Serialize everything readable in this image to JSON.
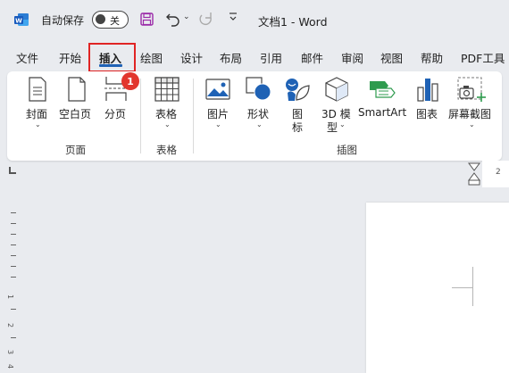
{
  "titlebar": {
    "autosave_label": "自动保存",
    "autosave_state": "关",
    "doc_title": "文档1  -  Word"
  },
  "tabs": [
    {
      "label": "文件"
    },
    {
      "label": "开始"
    },
    {
      "label": "插入",
      "active": true
    },
    {
      "label": "绘图"
    },
    {
      "label": "设计"
    },
    {
      "label": "布局"
    },
    {
      "label": "引用"
    },
    {
      "label": "邮件"
    },
    {
      "label": "审阅"
    },
    {
      "label": "视图"
    },
    {
      "label": "帮助"
    },
    {
      "label": "PDF工具"
    }
  ],
  "annotation": {
    "badge_number": "1",
    "highlight_color": "#e02424"
  },
  "ribbon": {
    "groups": {
      "pages": "页面",
      "tables": "表格",
      "illustrations": "插图"
    },
    "buttons": {
      "cover": "封面",
      "blank_page": "空白页",
      "page_break": "分页",
      "table": "表格",
      "pictures": "图片",
      "shapes": "形状",
      "icons_line1": "图",
      "icons_line2": "标",
      "model_line1": "3D 模",
      "model_line2": "型",
      "smartart": "SmartArt",
      "chart": "图表",
      "screenshot": "屏幕截图"
    }
  },
  "ruler": {
    "h_number": "2",
    "v_numbers": [
      "1",
      "2",
      "3",
      "4"
    ]
  },
  "colors": {
    "accent": "#1f62b5",
    "badge": "#e2362e",
    "background": "#e9ebef"
  }
}
